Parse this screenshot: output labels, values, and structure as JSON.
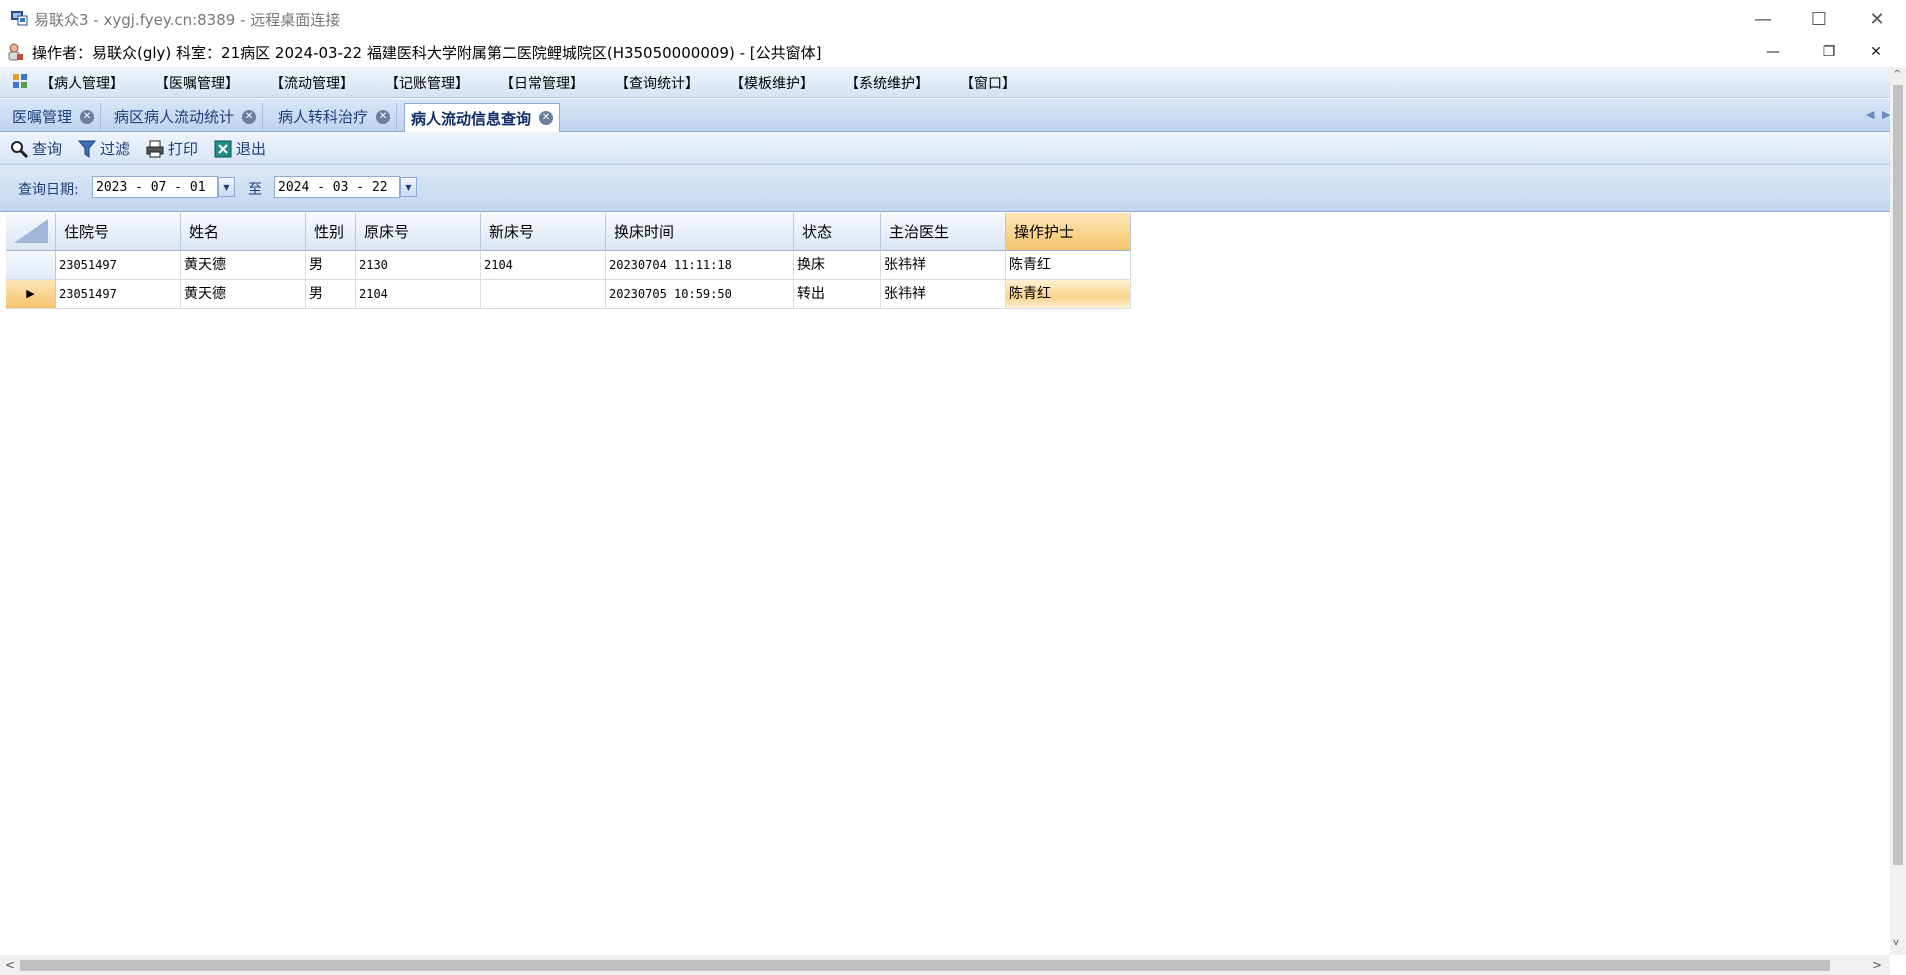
{
  "window": {
    "title": "易联众3 - xygj.fyey.cn:8389 - 远程桌面连接",
    "minimize": "—",
    "maximize": "☐",
    "close": "✕"
  },
  "info": {
    "text": "操作者：易联众(gly)  科室：21病区  2024-03-22  福建医科大学附属第二医院鲤城院区(H35050000009) - [公共窗体]",
    "minimize": "—",
    "restore": "❐",
    "close": "✕"
  },
  "menu": [
    "【病人管理】",
    "【医嘱管理】",
    "【流动管理】",
    "【记账管理】",
    "【日常管理】",
    "【查询统计】",
    "【模板维护】",
    "【系统维护】",
    "【窗口】"
  ],
  "tabs": [
    {
      "label": "医嘱管理"
    },
    {
      "label": "病区病人流动统计"
    },
    {
      "label": "病人转科治疗"
    },
    {
      "label": "病人流动信息查询"
    }
  ],
  "tab_close": "✕",
  "toolbar": {
    "query": "查询",
    "filter": "过滤",
    "print": "打印",
    "exit": "退出"
  },
  "filter": {
    "date_label": "查询日期:",
    "start_date": "2023 - 07 - 01",
    "to_label": "至",
    "end_date": "2024 - 03 - 22",
    "dropdown_glyph": "▼"
  },
  "table": {
    "columns": [
      "住院号",
      "姓名",
      "性别",
      "原床号",
      "新床号",
      "换床时间",
      "状态",
      "主治医生",
      "操作护士"
    ],
    "rows": [
      [
        "23051497",
        "黄天德",
        "男",
        "2130",
        "2104",
        "20230704 11:11:18",
        "换床",
        "张祎祥",
        "陈青红"
      ],
      [
        "23051497",
        "黄天德",
        "男",
        "2104",
        "",
        "20230705 10:59:50",
        "转出",
        "张祎祥",
        "陈青红"
      ]
    ],
    "current_row_marker": "▶"
  },
  "scroll": {
    "left": "<",
    "right": ">",
    "up": "^",
    "down": "v"
  },
  "colors": {
    "accent": "#1e3f7a",
    "selected_header": "#f6c46c"
  }
}
